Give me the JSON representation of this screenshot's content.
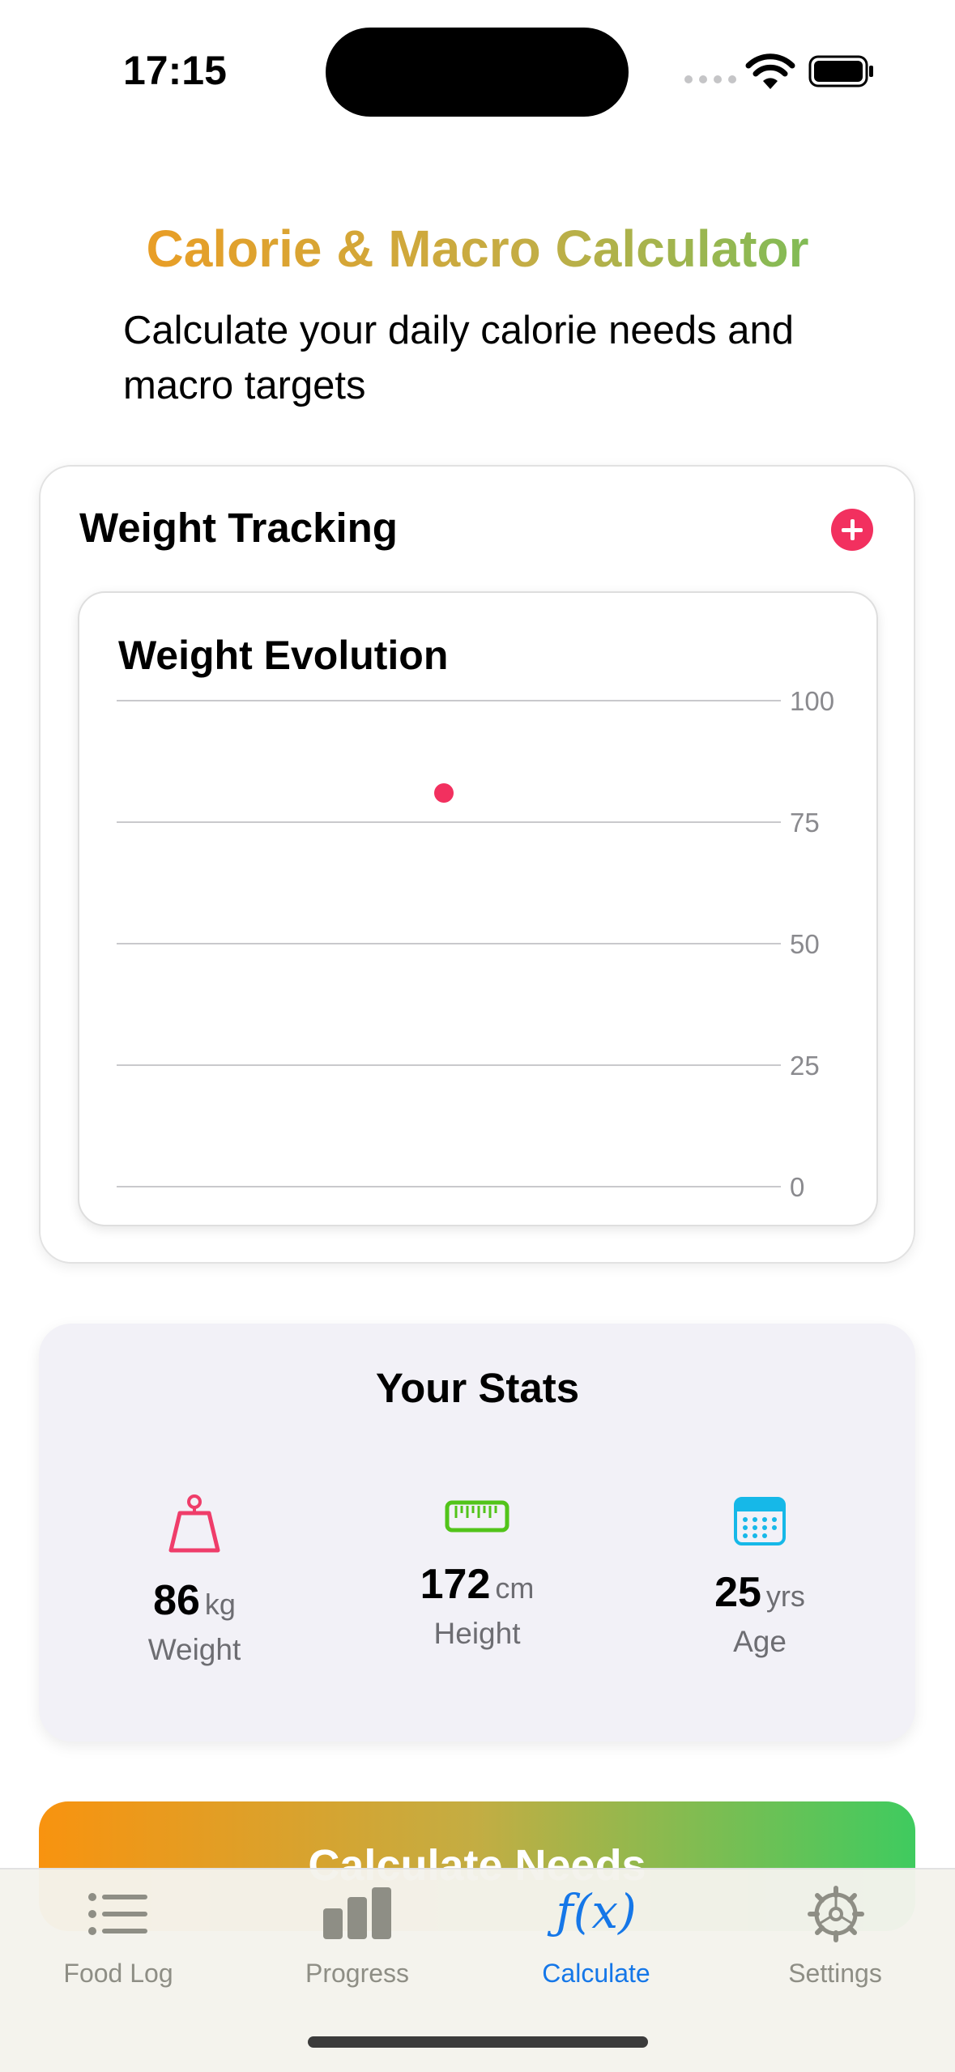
{
  "status_bar": {
    "time": "17:15"
  },
  "header": {
    "title": "Calorie & Macro Calculator",
    "subtitle": "Calculate your daily calorie needs and macro targets"
  },
  "weight_tracking": {
    "title": "Weight Tracking",
    "add_icon": "plus-circle-icon",
    "chart_title": "Weight Evolution"
  },
  "chart_data": {
    "type": "scatter",
    "title": "Weight Evolution",
    "ylim": [
      0,
      100
    ],
    "yticks": [
      "100",
      "75",
      "50",
      "25",
      "0"
    ],
    "points": [
      {
        "y": 81
      }
    ],
    "grid": true,
    "y_axis_position": "right",
    "point_color": "#f2305f"
  },
  "stats": {
    "title": "Your Stats",
    "items": [
      {
        "value": "86",
        "unit": "kg",
        "label": "Weight",
        "icon": "weight-icon",
        "bg": "#f2dfe8",
        "color": "#ef3d6a"
      },
      {
        "value": "172",
        "unit": "cm",
        "label": "Height",
        "icon": "ruler-icon",
        "bg": "#e1eddc",
        "color": "#52c41a"
      },
      {
        "value": "25",
        "unit": "yrs",
        "label": "Age",
        "icon": "calendar-icon",
        "bg": "#dcecf4",
        "color": "#16b8e8"
      }
    ]
  },
  "calculate_button": {
    "label": "Calculate Needs"
  },
  "tabbar": {
    "items": [
      {
        "label": "Food Log",
        "icon": "list-icon",
        "active": false
      },
      {
        "label": "Progress",
        "icon": "bar-chart-icon",
        "active": false
      },
      {
        "label": "Calculate",
        "icon": "function-icon",
        "active": true
      },
      {
        "label": "Settings",
        "icon": "gear-icon",
        "active": false
      }
    ]
  },
  "colors": {
    "accent_pink": "#f2305f",
    "tab_active": "#1577e8",
    "tab_inactive": "#8e8e85"
  }
}
